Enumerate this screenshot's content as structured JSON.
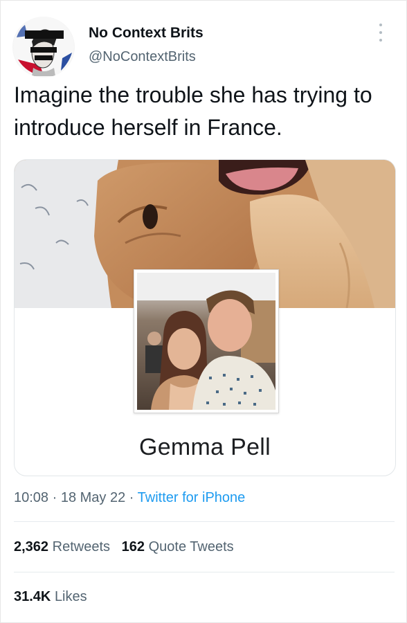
{
  "account": {
    "name": "No Context Brits",
    "handle": "@NoContextBrits"
  },
  "tweet": {
    "text": "Imagine the trouble she has trying to introduce herself in France."
  },
  "card": {
    "profile_name": "Gemma Pell"
  },
  "meta": {
    "time": "10:08",
    "sep1": " · ",
    "date": "18 May 22",
    "sep2": " · ",
    "source": "Twitter for iPhone"
  },
  "stats": {
    "retweets_count": "2,362",
    "retweets_label": "Retweets",
    "quotes_count": "162",
    "quotes_label": "Quote Tweets",
    "likes_count": "31.4K",
    "likes_label": "Likes"
  },
  "colors": {
    "link": "#1d9bf0",
    "secondary_text": "#536471"
  }
}
